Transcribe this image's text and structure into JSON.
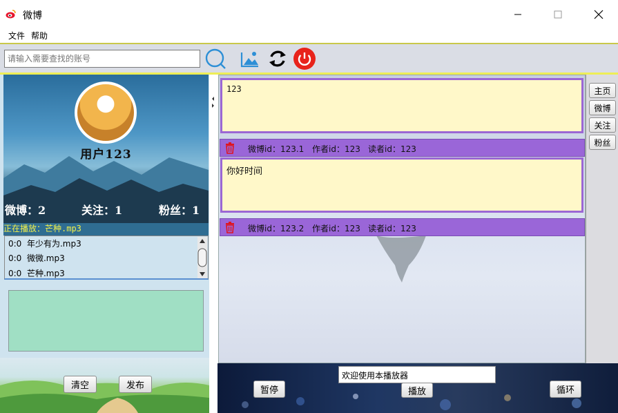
{
  "window": {
    "title": "微博"
  },
  "menu": {
    "file": "文件",
    "help": "帮助"
  },
  "toolbar": {
    "search_placeholder": "请输入需要查找的账号"
  },
  "profile": {
    "username": "用户123",
    "stats": {
      "weibo": "微博：2",
      "follow": "关注：1",
      "fans": "粉丝：1"
    }
  },
  "player_panel": {
    "now_playing": "正在播放：芒种.mp3",
    "tracks": [
      {
        "time": "0:0",
        "name": "年少有为.mp3"
      },
      {
        "time": "0:0",
        "name": "微微.mp3"
      },
      {
        "time": "0:0",
        "name": "芒种.mp3"
      }
    ]
  },
  "compose": {
    "clear": "清空",
    "publish": "发布"
  },
  "feed": {
    "posts": [
      {
        "content": "123",
        "weibo_id": "微博id：123.1",
        "author_id": "作者id：123",
        "reader_id": "读者id：123"
      },
      {
        "content": "你好时间",
        "weibo_id": "微博id：123.2",
        "author_id": "作者id：123",
        "reader_id": "读者id：123"
      }
    ]
  },
  "sidebar_tabs": {
    "home": "主页",
    "weibo": "微博",
    "follow": "关注",
    "fans": "粉丝"
  },
  "music_player": {
    "message": "欢迎使用本播放器",
    "pause": "暂停",
    "play": "播放",
    "loop": "循环"
  },
  "colors": {
    "accent_purple": "#9a66d8",
    "post_background": "#fff8c9",
    "now_playing_text": "#f3f04a",
    "power_red": "#e8231b",
    "search_blue": "#2d8fd6"
  }
}
